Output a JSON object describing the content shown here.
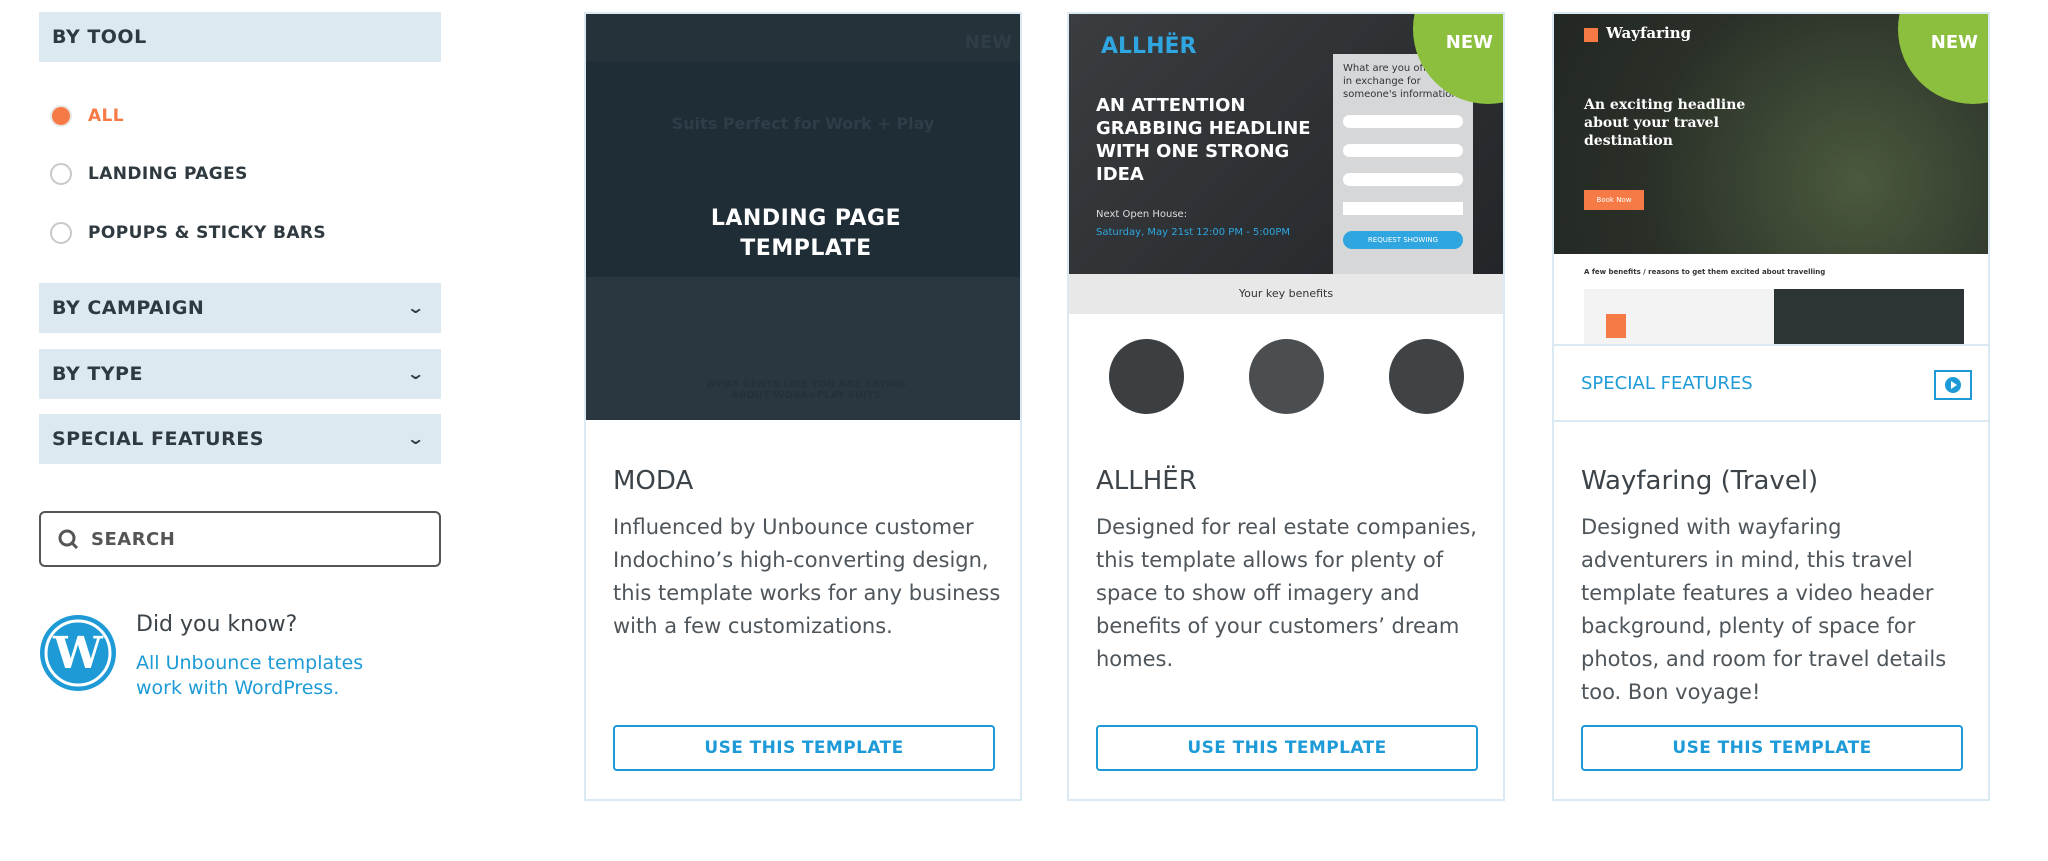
{
  "sidebar": {
    "by_tool": "BY TOOL",
    "options": [
      {
        "label": "ALL",
        "selected": true
      },
      {
        "label": "LANDING PAGES",
        "selected": false
      },
      {
        "label": "POPUPS & STICKY BARS",
        "selected": false
      }
    ],
    "sections": [
      "BY CAMPAIGN",
      "BY TYPE",
      "SPECIAL FEATURES"
    ],
    "search_placeholder": "SEARCH",
    "did_you_know": "Did you know?",
    "wp_link_line1": "All Unbounce templates",
    "wp_link_line2": "work with WordPress."
  },
  "colors": {
    "accent": "#1e9bd7",
    "selected": "#f57a45",
    "new_badge": "#8dbf3f",
    "filter_bg": "#dde9f1"
  },
  "cards": [
    {
      "title": "MODA",
      "description": "Influenced by Unbounce customer Indochino’s high-converting design, this template works for any business with a few customizations.",
      "button": "USE THIS TEMPLATE",
      "overlay": "LANDING PAGE TEMPLATE",
      "badge": "NEW",
      "preview_heading": "Suits Perfect for Work + Play",
      "preview_footer": "WHAT GENTS LIKE YOU ARE SAYING ABOUT WORK+PLAY SUITS"
    },
    {
      "title": "ALLHËR",
      "description": "Designed for real estate companies, this template allows for plenty of space to show off imagery and benefits of your customers’ dream homes.",
      "button": "USE THIS TEMPLATE",
      "badge": "NEW",
      "preview_logo": "ALLHËR",
      "preview_headline": "AN ATTENTION GRABBING HEADLINE WITH ONE STRONG IDEA",
      "preview_open": "Next Open House:",
      "preview_date": "Saturday, May 21st 12:00 PM - 5:00PM",
      "preview_form_q": "What are you offering in exchange for someone's information?",
      "preview_form_btn": "REQUEST SHOWING",
      "preview_benefits": "Your key benefits"
    },
    {
      "title": "Wayfaring (Travel)",
      "description": "Designed with wayfaring adventurers in mind, this travel template features a video header background, plenty of space for photos, and room for travel details too. Bon voyage!",
      "button": "USE THIS TEMPLATE",
      "badge": "NEW",
      "preview_logo": "Wayfaring",
      "preview_headline": "An exciting headline about your travel destination",
      "preview_btn": "Book Now",
      "preview_sub": "A few benefits / reasons to get them excited about travelling",
      "feature_label": "SPECIAL FEATURES",
      "feature_icon": "play-video-icon"
    }
  ]
}
